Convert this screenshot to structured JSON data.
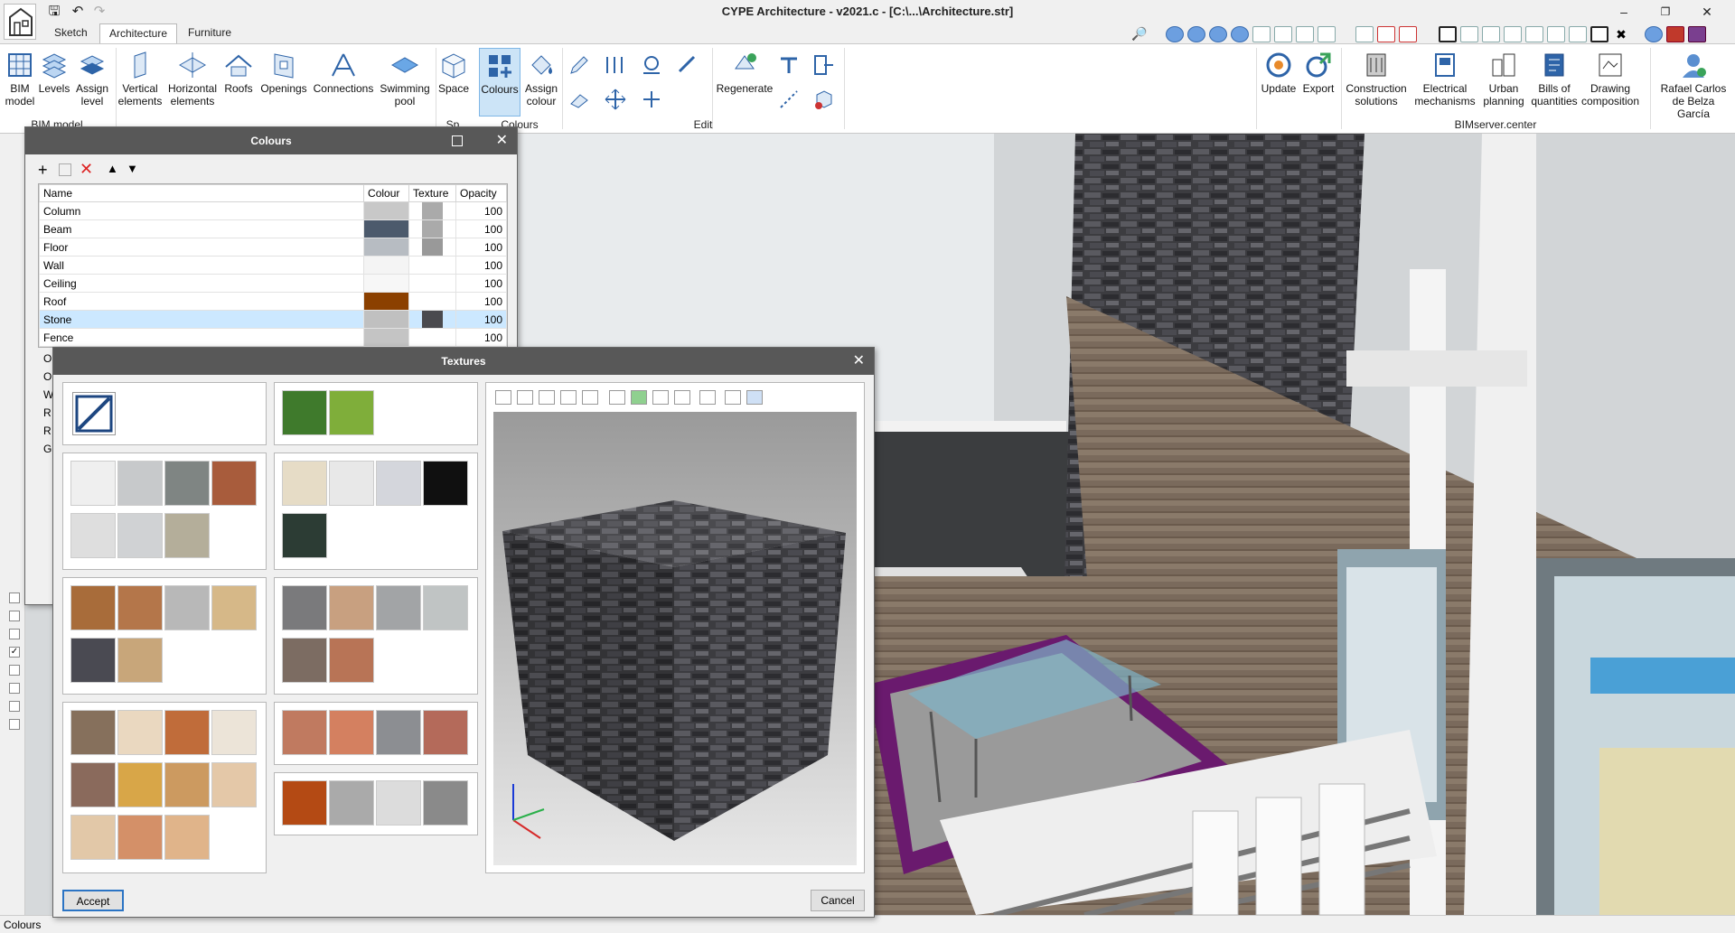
{
  "app": {
    "title": "CYPE Architecture - v2021.c - [C:\\...\\Architecture.str]"
  },
  "tabs": [
    {
      "label": "Sketch"
    },
    {
      "label": "Architecture"
    },
    {
      "label": "Furniture"
    }
  ],
  "ribbon": {
    "buttons": [
      "BIM model",
      "Levels",
      "Assign level",
      "Vertical elements",
      "Horizontal elements",
      "Roofs",
      "Openings",
      "Connections",
      "Swimming pool",
      "Space",
      "Colours",
      "Assign colour",
      "Regenerate",
      "Update",
      "Export",
      "Construction solutions",
      "Electrical mechanisms",
      "Urban planning",
      "Bills of quantities",
      "Drawing composition",
      "Rafael Carlos de Belza García"
    ],
    "groups": [
      "BIM model",
      "Sp...",
      "Colours",
      "Edit",
      "BIMserver.center"
    ]
  },
  "colours_dialog": {
    "title": "Colours",
    "columns": [
      "Name",
      "Colour",
      "Texture",
      "Opacity"
    ],
    "rows": [
      {
        "name": "Column",
        "colour": "#c8c8c8",
        "texture": "#aaaaaa",
        "opacity": "100"
      },
      {
        "name": "Beam",
        "colour": "#4c5a6c",
        "texture": "#aaaaaa",
        "opacity": "100"
      },
      {
        "name": "Floor",
        "colour": "#b7bcc2",
        "texture": "#999999",
        "opacity": "100"
      },
      {
        "name": "Wall",
        "colour": "#f4f4f4",
        "texture": "",
        "opacity": "100"
      },
      {
        "name": "Ceiling",
        "colour": "#f7f7f7",
        "texture": "",
        "opacity": "100"
      },
      {
        "name": "Roof",
        "colour": "#8b4000",
        "texture": "",
        "opacity": "100"
      },
      {
        "name": "Stone",
        "colour": "#c0c0c0",
        "texture": "#4a4a4e",
        "opacity": "100"
      },
      {
        "name": "Fence",
        "colour": "#c4c4c4",
        "texture": "",
        "opacity": "100"
      }
    ],
    "partial_names": [
      "O",
      "O",
      "W",
      "R",
      "R",
      "G"
    ]
  },
  "textures_dialog": {
    "title": "Textures",
    "accept_label": "Accept",
    "cancel_label": "Cancel"
  },
  "statusbar": {
    "text": "Colours"
  },
  "colors": {
    "titlebar": "#585858",
    "accent": "#2b74c4",
    "selection": "#cce8ff"
  }
}
